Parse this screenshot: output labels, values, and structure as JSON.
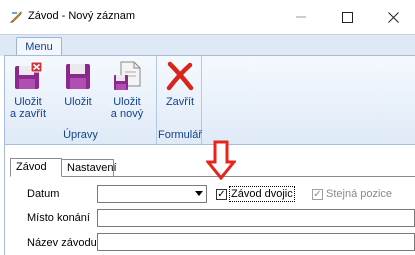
{
  "window": {
    "title": "Závod - Nový záznam",
    "minimize": "—",
    "maximize": "☐",
    "close": "✕"
  },
  "ribbon": {
    "tab": "Menu",
    "groups": {
      "upravy": {
        "label": "Úpravy",
        "buttons": {
          "save_close": [
            "Uložit",
            "a zavřít"
          ],
          "save": [
            "Uložit"
          ],
          "save_new": [
            "Uložit",
            "a nový"
          ]
        }
      },
      "formular": {
        "label": "Formulář",
        "buttons": {
          "close": [
            "Zavřít"
          ]
        }
      }
    }
  },
  "form": {
    "tabs": [
      "Závod",
      "Nastavení"
    ],
    "fields": {
      "datum": {
        "label": "Datum",
        "value": ""
      },
      "misto": {
        "label": "Místo konání",
        "value": ""
      },
      "nazev": {
        "label": "Název závodu",
        "value": ""
      }
    },
    "checkboxes": {
      "zavod_dvojic": {
        "label": "Závod dvojic",
        "checked": true,
        "mark": "✓"
      },
      "stejna_pozice": {
        "label": "Stejná pozice",
        "checked": true,
        "mark": "✓",
        "disabled": true
      }
    }
  },
  "colors": {
    "ribbon_text": "#15428b",
    "arrow": "#e8241c",
    "disabled_text": "#8a8a8a"
  }
}
